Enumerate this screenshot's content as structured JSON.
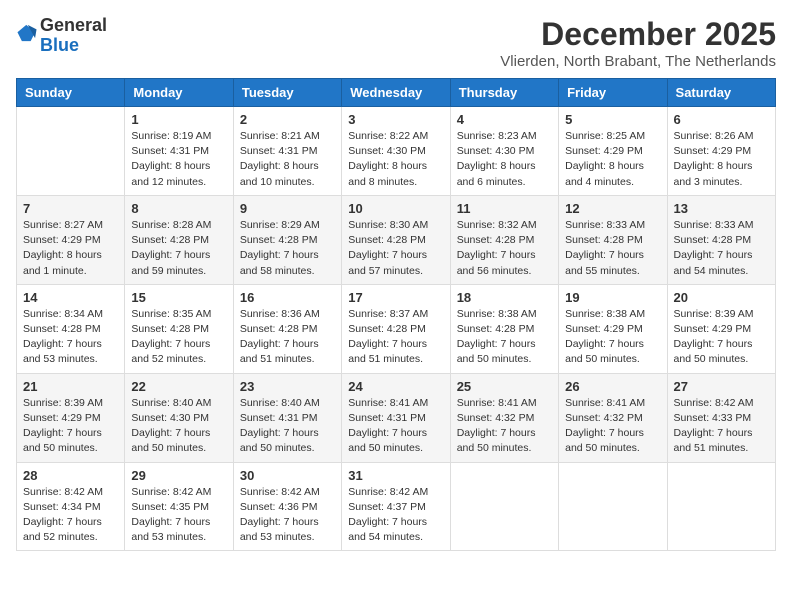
{
  "logo": {
    "general": "General",
    "blue": "Blue"
  },
  "header": {
    "month": "December 2025",
    "location": "Vlierden, North Brabant, The Netherlands"
  },
  "weekdays": [
    "Sunday",
    "Monday",
    "Tuesday",
    "Wednesday",
    "Thursday",
    "Friday",
    "Saturday"
  ],
  "weeks": [
    [
      {
        "day": "",
        "sunrise": "",
        "sunset": "",
        "daylight": ""
      },
      {
        "day": "1",
        "sunrise": "Sunrise: 8:19 AM",
        "sunset": "Sunset: 4:31 PM",
        "daylight": "Daylight: 8 hours and 12 minutes."
      },
      {
        "day": "2",
        "sunrise": "Sunrise: 8:21 AM",
        "sunset": "Sunset: 4:31 PM",
        "daylight": "Daylight: 8 hours and 10 minutes."
      },
      {
        "day": "3",
        "sunrise": "Sunrise: 8:22 AM",
        "sunset": "Sunset: 4:30 PM",
        "daylight": "Daylight: 8 hours and 8 minutes."
      },
      {
        "day": "4",
        "sunrise": "Sunrise: 8:23 AM",
        "sunset": "Sunset: 4:30 PM",
        "daylight": "Daylight: 8 hours and 6 minutes."
      },
      {
        "day": "5",
        "sunrise": "Sunrise: 8:25 AM",
        "sunset": "Sunset: 4:29 PM",
        "daylight": "Daylight: 8 hours and 4 minutes."
      },
      {
        "day": "6",
        "sunrise": "Sunrise: 8:26 AM",
        "sunset": "Sunset: 4:29 PM",
        "daylight": "Daylight: 8 hours and 3 minutes."
      }
    ],
    [
      {
        "day": "7",
        "sunrise": "Sunrise: 8:27 AM",
        "sunset": "Sunset: 4:29 PM",
        "daylight": "Daylight: 8 hours and 1 minute."
      },
      {
        "day": "8",
        "sunrise": "Sunrise: 8:28 AM",
        "sunset": "Sunset: 4:28 PM",
        "daylight": "Daylight: 7 hours and 59 minutes."
      },
      {
        "day": "9",
        "sunrise": "Sunrise: 8:29 AM",
        "sunset": "Sunset: 4:28 PM",
        "daylight": "Daylight: 7 hours and 58 minutes."
      },
      {
        "day": "10",
        "sunrise": "Sunrise: 8:30 AM",
        "sunset": "Sunset: 4:28 PM",
        "daylight": "Daylight: 7 hours and 57 minutes."
      },
      {
        "day": "11",
        "sunrise": "Sunrise: 8:32 AM",
        "sunset": "Sunset: 4:28 PM",
        "daylight": "Daylight: 7 hours and 56 minutes."
      },
      {
        "day": "12",
        "sunrise": "Sunrise: 8:33 AM",
        "sunset": "Sunset: 4:28 PM",
        "daylight": "Daylight: 7 hours and 55 minutes."
      },
      {
        "day": "13",
        "sunrise": "Sunrise: 8:33 AM",
        "sunset": "Sunset: 4:28 PM",
        "daylight": "Daylight: 7 hours and 54 minutes."
      }
    ],
    [
      {
        "day": "14",
        "sunrise": "Sunrise: 8:34 AM",
        "sunset": "Sunset: 4:28 PM",
        "daylight": "Daylight: 7 hours and 53 minutes."
      },
      {
        "day": "15",
        "sunrise": "Sunrise: 8:35 AM",
        "sunset": "Sunset: 4:28 PM",
        "daylight": "Daylight: 7 hours and 52 minutes."
      },
      {
        "day": "16",
        "sunrise": "Sunrise: 8:36 AM",
        "sunset": "Sunset: 4:28 PM",
        "daylight": "Daylight: 7 hours and 51 minutes."
      },
      {
        "day": "17",
        "sunrise": "Sunrise: 8:37 AM",
        "sunset": "Sunset: 4:28 PM",
        "daylight": "Daylight: 7 hours and 51 minutes."
      },
      {
        "day": "18",
        "sunrise": "Sunrise: 8:38 AM",
        "sunset": "Sunset: 4:28 PM",
        "daylight": "Daylight: 7 hours and 50 minutes."
      },
      {
        "day": "19",
        "sunrise": "Sunrise: 8:38 AM",
        "sunset": "Sunset: 4:29 PM",
        "daylight": "Daylight: 7 hours and 50 minutes."
      },
      {
        "day": "20",
        "sunrise": "Sunrise: 8:39 AM",
        "sunset": "Sunset: 4:29 PM",
        "daylight": "Daylight: 7 hours and 50 minutes."
      }
    ],
    [
      {
        "day": "21",
        "sunrise": "Sunrise: 8:39 AM",
        "sunset": "Sunset: 4:29 PM",
        "daylight": "Daylight: 7 hours and 50 minutes."
      },
      {
        "day": "22",
        "sunrise": "Sunrise: 8:40 AM",
        "sunset": "Sunset: 4:30 PM",
        "daylight": "Daylight: 7 hours and 50 minutes."
      },
      {
        "day": "23",
        "sunrise": "Sunrise: 8:40 AM",
        "sunset": "Sunset: 4:31 PM",
        "daylight": "Daylight: 7 hours and 50 minutes."
      },
      {
        "day": "24",
        "sunrise": "Sunrise: 8:41 AM",
        "sunset": "Sunset: 4:31 PM",
        "daylight": "Daylight: 7 hours and 50 minutes."
      },
      {
        "day": "25",
        "sunrise": "Sunrise: 8:41 AM",
        "sunset": "Sunset: 4:32 PM",
        "daylight": "Daylight: 7 hours and 50 minutes."
      },
      {
        "day": "26",
        "sunrise": "Sunrise: 8:41 AM",
        "sunset": "Sunset: 4:32 PM",
        "daylight": "Daylight: 7 hours and 50 minutes."
      },
      {
        "day": "27",
        "sunrise": "Sunrise: 8:42 AM",
        "sunset": "Sunset: 4:33 PM",
        "daylight": "Daylight: 7 hours and 51 minutes."
      }
    ],
    [
      {
        "day": "28",
        "sunrise": "Sunrise: 8:42 AM",
        "sunset": "Sunset: 4:34 PM",
        "daylight": "Daylight: 7 hours and 52 minutes."
      },
      {
        "day": "29",
        "sunrise": "Sunrise: 8:42 AM",
        "sunset": "Sunset: 4:35 PM",
        "daylight": "Daylight: 7 hours and 53 minutes."
      },
      {
        "day": "30",
        "sunrise": "Sunrise: 8:42 AM",
        "sunset": "Sunset: 4:36 PM",
        "daylight": "Daylight: 7 hours and 53 minutes."
      },
      {
        "day": "31",
        "sunrise": "Sunrise: 8:42 AM",
        "sunset": "Sunset: 4:37 PM",
        "daylight": "Daylight: 7 hours and 54 minutes."
      },
      {
        "day": "",
        "sunrise": "",
        "sunset": "",
        "daylight": ""
      },
      {
        "day": "",
        "sunrise": "",
        "sunset": "",
        "daylight": ""
      },
      {
        "day": "",
        "sunrise": "",
        "sunset": "",
        "daylight": ""
      }
    ]
  ]
}
